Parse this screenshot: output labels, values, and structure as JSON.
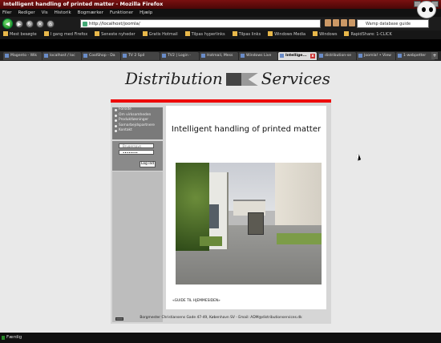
{
  "window": {
    "title": "Intelligent handling of printed matter - Mozilla Firefox"
  },
  "menu": [
    "Filer",
    "Rediger",
    "Vis",
    "Historik",
    "Bogmærker",
    "Funktioner",
    "Hjælp"
  ],
  "nav": {
    "url": "http://localhost/joomla/",
    "search": "Wamp database guide"
  },
  "bookmarks": [
    "Mest besøgte",
    "I gang med Firefox",
    "Seneste nyheder",
    "Gratis Hotmail",
    "Tilpas hyperlinks",
    "Tilpas links",
    "Windows Media",
    "Windows",
    "RapidShare: 1-CLICK"
  ],
  "tabs": [
    {
      "label": "Magento - Wik"
    },
    {
      "label": "localhost / loc"
    },
    {
      "label": "CoolShop - Da"
    },
    {
      "label": "TV 2 Spil"
    },
    {
      "label": "TV2 | Login -"
    },
    {
      "label": "Hotmail, Mess"
    },
    {
      "label": "Windows Live"
    },
    {
      "label": "Intellige..."
    },
    {
      "label": "distribution-se"
    },
    {
      "label": "Joomla! • View"
    },
    {
      "label": "1-webpetter"
    }
  ],
  "active_tab_close": "x",
  "tabs_more": "+",
  "page": {
    "logo_left": "Distribution",
    "logo_right": "Services",
    "menu_items": [
      "Forside",
      "Om virksomheden",
      "Produktløsninger",
      "Samarbejdspartnere",
      "Kontakt"
    ],
    "login": {
      "username_placeholder": "Brugernavn",
      "password_value": "••••••••",
      "button": "Log ind"
    },
    "heading": "Intelligent handling of printed matter",
    "guide_link": "«GUIDE TIL HJEMMESIDEN»",
    "footer": "Borgmester Christiansens Gade 47-49, København SV - Email: ADM@distributionservices.dk"
  },
  "status": "Færdig"
}
